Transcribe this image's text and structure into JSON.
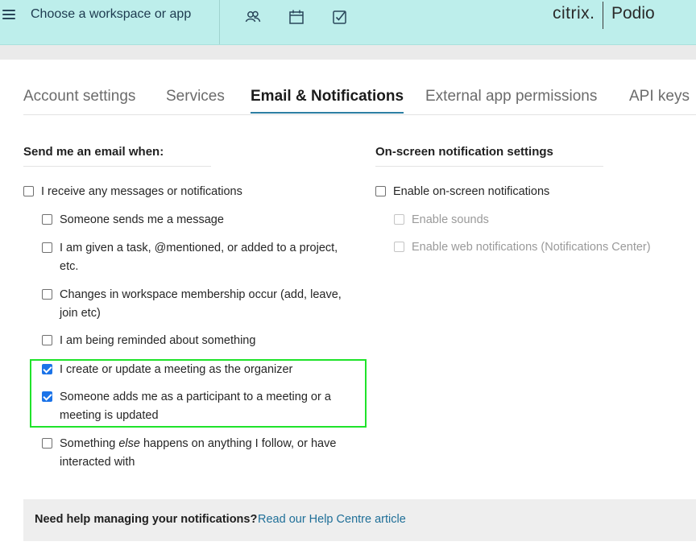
{
  "header": {
    "workspace_label": "Choose a workspace or app",
    "icons": [
      "contacts-icon",
      "calendar-icon",
      "tasks-check-icon"
    ],
    "brand_citrix": "citrix.",
    "brand_podio": "Podio"
  },
  "tabs": [
    {
      "label": "Account settings",
      "active": false
    },
    {
      "label": "Services",
      "active": false
    },
    {
      "label": "Email & Notifications",
      "active": true
    },
    {
      "label": "External app permissions",
      "active": false
    },
    {
      "label": "API keys",
      "active": false
    }
  ],
  "email": {
    "title": "Send me an email when:",
    "master": {
      "label": "I receive any messages or notifications",
      "checked": false
    },
    "items": [
      {
        "label": "Someone sends me a message",
        "checked": false
      },
      {
        "label": "I am given a task, @mentioned, or added to a project, etc.",
        "checked": false
      },
      {
        "label": "Changes in workspace membership occur (add, leave, join etc)",
        "checked": false
      },
      {
        "label": "I am being reminded about something",
        "checked": false
      },
      {
        "label": "I create or update a meeting as the organizer",
        "checked": true
      },
      {
        "label": "Someone adds me as a participant to a meeting or a meeting is updated",
        "checked": true
      },
      {
        "label_before": "Something ",
        "label_em": "else",
        "label_after": " happens on anything I follow, or have interacted with",
        "checked": false
      }
    ]
  },
  "onscreen": {
    "title": "On-screen notification settings",
    "master": {
      "label": "Enable on-screen notifications",
      "checked": false
    },
    "items": [
      {
        "label": "Enable sounds",
        "checked": false,
        "disabled": true
      },
      {
        "label": "Enable web notifications (Notifications Center)",
        "checked": false,
        "disabled": true
      }
    ]
  },
  "help": {
    "text": "Need help managing your notifications?",
    "link": "Read our Help Centre article"
  },
  "colors": {
    "topbar": "#bdeeeb",
    "accent": "#2d7fa3",
    "checkbox_checked": "#1b73e8",
    "highlight": "#1fe32a",
    "link": "#1f6f98"
  }
}
